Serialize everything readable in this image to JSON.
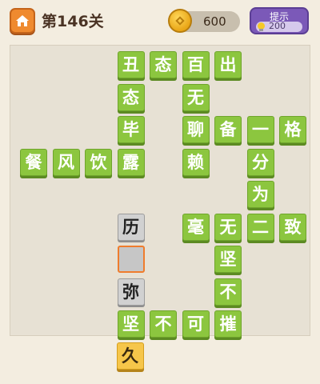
{
  "header": {
    "level_title": "第146关",
    "coins": "600",
    "hint_label": "提示",
    "hint_cost": "200"
  },
  "colors": {
    "tile_green": "#8cc63f",
    "tile_gray": "#d1d1d1",
    "tile_yellow": "#f6c64a",
    "selected_border": "#ef7c2c",
    "hint_purple": "#7b59b8",
    "home_orange": "#ef8a2f"
  },
  "grid": {
    "cells": [
      {
        "row": 0,
        "col": 3,
        "char": "丑",
        "state": "green"
      },
      {
        "row": 0,
        "col": 4,
        "char": "态",
        "state": "green"
      },
      {
        "row": 0,
        "col": 5,
        "char": "百",
        "state": "green"
      },
      {
        "row": 0,
        "col": 6,
        "char": "出",
        "state": "green"
      },
      {
        "row": 1,
        "col": 3,
        "char": "态",
        "state": "green"
      },
      {
        "row": 1,
        "col": 5,
        "char": "无",
        "state": "green"
      },
      {
        "row": 2,
        "col": 3,
        "char": "毕",
        "state": "green"
      },
      {
        "row": 2,
        "col": 5,
        "char": "聊",
        "state": "green"
      },
      {
        "row": 2,
        "col": 6,
        "char": "备",
        "state": "green"
      },
      {
        "row": 2,
        "col": 7,
        "char": "一",
        "state": "green"
      },
      {
        "row": 2,
        "col": 8,
        "char": "格",
        "state": "green"
      },
      {
        "row": 3,
        "col": 0,
        "char": "餐",
        "state": "green"
      },
      {
        "row": 3,
        "col": 1,
        "char": "风",
        "state": "green"
      },
      {
        "row": 3,
        "col": 2,
        "char": "饮",
        "state": "green"
      },
      {
        "row": 3,
        "col": 3,
        "char": "露",
        "state": "green"
      },
      {
        "row": 3,
        "col": 5,
        "char": "赖",
        "state": "green"
      },
      {
        "row": 3,
        "col": 7,
        "char": "分",
        "state": "green"
      },
      {
        "row": 4,
        "col": 7,
        "char": "为",
        "state": "green"
      },
      {
        "row": 5,
        "col": 3,
        "char": "历",
        "state": "gray"
      },
      {
        "row": 5,
        "col": 5,
        "char": "毫",
        "state": "green"
      },
      {
        "row": 5,
        "col": 6,
        "char": "无",
        "state": "green"
      },
      {
        "row": 5,
        "col": 7,
        "char": "二",
        "state": "green"
      },
      {
        "row": 5,
        "col": 8,
        "char": "致",
        "state": "green"
      },
      {
        "row": 6,
        "col": 3,
        "char": "",
        "state": "selected"
      },
      {
        "row": 6,
        "col": 6,
        "char": "坚",
        "state": "green"
      },
      {
        "row": 7,
        "col": 3,
        "char": "弥",
        "state": "gray"
      },
      {
        "row": 7,
        "col": 6,
        "char": "不",
        "state": "green"
      },
      {
        "row": 8,
        "col": 3,
        "char": "坚",
        "state": "green"
      },
      {
        "row": 8,
        "col": 4,
        "char": "不",
        "state": "green"
      },
      {
        "row": 8,
        "col": 5,
        "char": "可",
        "state": "green"
      },
      {
        "row": 8,
        "col": 6,
        "char": "摧",
        "state": "green"
      }
    ]
  },
  "choices": [
    {
      "char": "久",
      "state": "yellow"
    }
  ]
}
